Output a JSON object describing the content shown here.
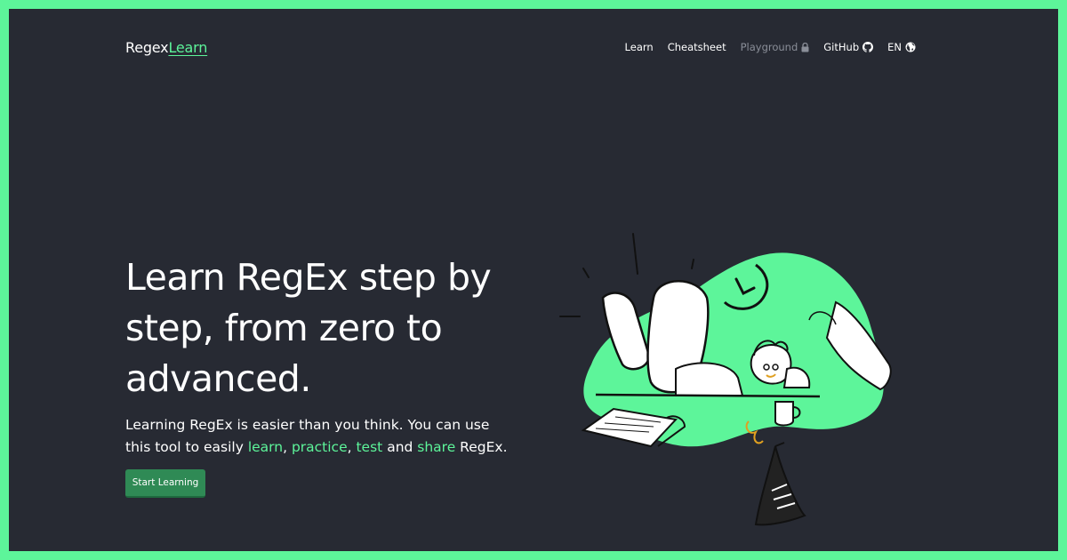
{
  "brand": {
    "prefix": "Regex",
    "accent": "Learn"
  },
  "nav": {
    "learn": "Learn",
    "cheatsheet": "Cheatsheet",
    "playground": "Playground",
    "github": "GitHub",
    "lang": "EN"
  },
  "hero": {
    "title": "Learn RegEx step by step, from zero to advanced.",
    "desc_prefix": "Learning RegEx is easier than you think. You can use this tool to easily ",
    "link_learn": "learn",
    "sep1": ", ",
    "link_practice": "practice",
    "sep2": ", ",
    "link_test": "test",
    "sep3": " and ",
    "link_share": "share",
    "desc_suffix": " RegEx.",
    "cta": "Start Learning"
  },
  "colors": {
    "accent": "#5df59a",
    "background": "#272a33",
    "button": "#2f8a55"
  },
  "icons": {
    "playground": "lock-icon",
    "github": "github-icon",
    "lang": "globe-icon"
  }
}
